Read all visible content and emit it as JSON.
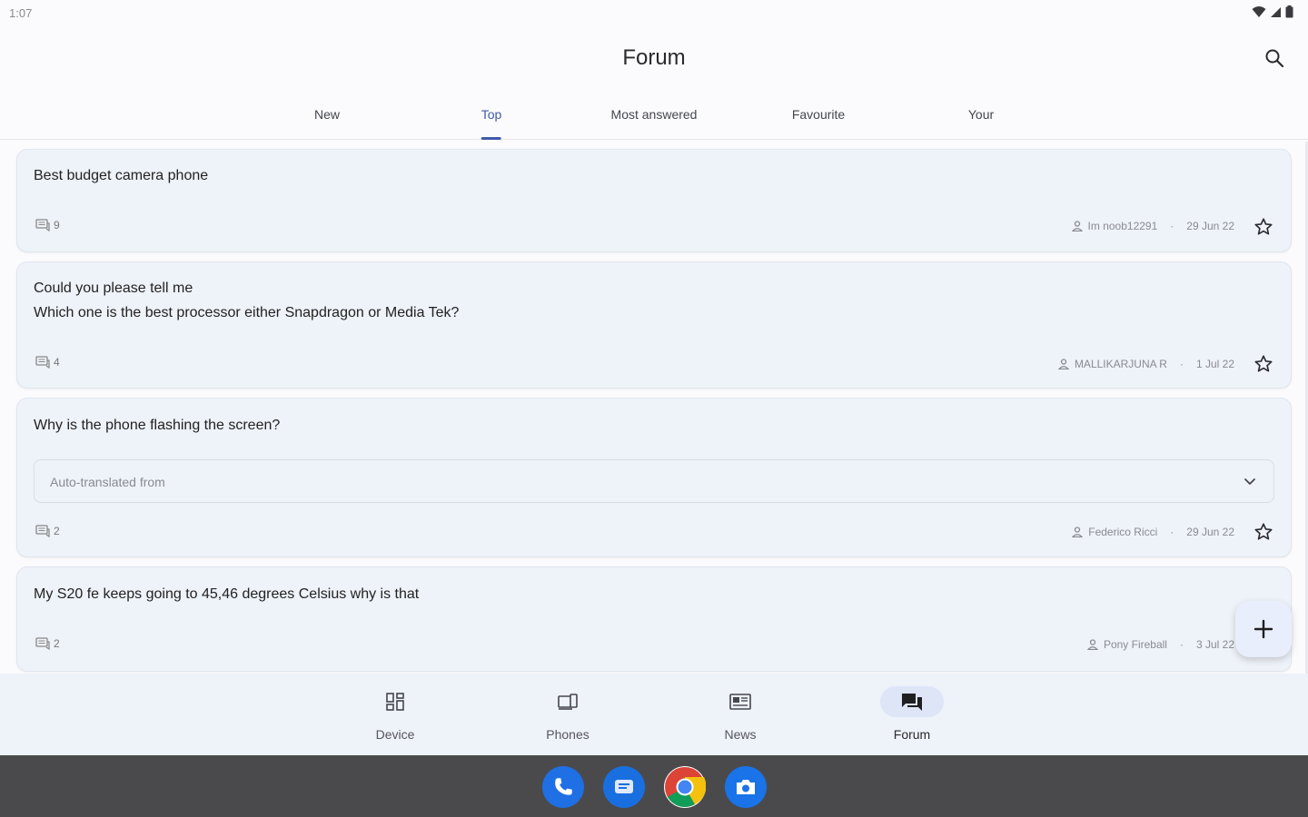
{
  "status": {
    "time": "1:07"
  },
  "app": {
    "title": "Forum"
  },
  "tabs": [
    {
      "label": "New",
      "active": false
    },
    {
      "label": "Top",
      "active": true
    },
    {
      "label": "Most answered",
      "active": false
    },
    {
      "label": "Favourite",
      "active": false
    },
    {
      "label": "Your",
      "active": false
    }
  ],
  "posts": [
    {
      "title_lines": [
        "Best budget camera phone"
      ],
      "comments": "9",
      "author": "Im noob12291",
      "date": "29 Jun 22"
    },
    {
      "title_lines": [
        "Could you please tell me",
        "Which one is the best processor either Snapdragon or Media Tek?"
      ],
      "comments": "4",
      "author": "MALLIKARJUNA R",
      "date": "1 Jul 22"
    },
    {
      "title_lines": [
        "Why is the phone flashing the screen?"
      ],
      "translation_label": "Auto-translated from",
      "comments": "2",
      "author": "Federico Ricci",
      "date": "29 Jun 22"
    },
    {
      "title_lines": [
        "My S20 fe keeps going to 45,46 degrees Celsius why is that"
      ],
      "comments": "2",
      "author": "Pony Fireball",
      "date": "3 Jul 22"
    }
  ],
  "bottom_nav": [
    {
      "label": "Device",
      "icon": "device-grid-icon",
      "active": false
    },
    {
      "label": "Phones",
      "icon": "phones-icon",
      "active": false
    },
    {
      "label": "News",
      "icon": "news-icon",
      "active": false
    },
    {
      "label": "Forum",
      "icon": "forum-chat-icon",
      "active": true
    }
  ],
  "dock": [
    "phone-app-icon",
    "messages-app-icon",
    "chrome-app-icon",
    "camera-app-icon"
  ],
  "colors": {
    "accent": "#3f5aa9",
    "card_bg": "#eef2f9",
    "taskbar": "#4a4a4d"
  }
}
